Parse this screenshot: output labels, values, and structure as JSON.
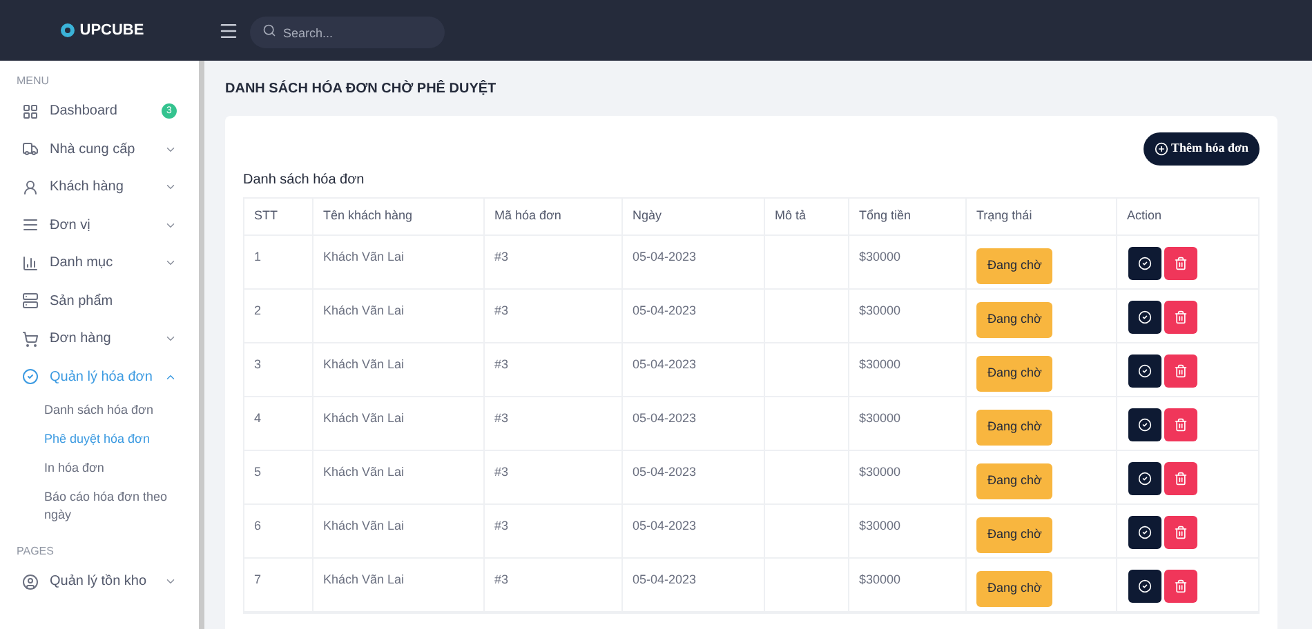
{
  "topbar": {
    "logo": "UPCUBE",
    "search": {
      "placeholder": "Search..."
    }
  },
  "sidebar": {
    "sections": [
      {
        "heading": "MENU",
        "items": [
          {
            "label": "Dashboard",
            "badge": "3",
            "color": "#34c38f",
            "selected": false
          },
          {
            "label": "Nhà cung cấp",
            "expanded": false,
            "selected": false
          },
          {
            "label": "Khách hàng",
            "expanded": false,
            "selected": false
          },
          {
            "label": "Đơn vị",
            "expanded": false,
            "selected": false
          },
          {
            "label": "Danh mục",
            "expanded": false,
            "selected": false
          },
          {
            "label": "Sản phẩm",
            "selected": false
          },
          {
            "label": "Đơn hàng",
            "expanded": false,
            "selected": false
          },
          {
            "label": "Quản lý hóa đơn",
            "expanded": true,
            "selected": true,
            "children": [
              {
                "label": "Danh sách hóa đơn",
                "selected": false
              },
              {
                "label": "Phê duyệt hóa đơn",
                "selected": true
              },
              {
                "label": "In hóa đơn",
                "selected": false
              },
              {
                "label": "Báo cáo hóa đơn theo ngày",
                "selected": false
              }
            ]
          }
        ]
      },
      {
        "heading": "PAGES",
        "items": [
          {
            "label": "Quản lý tồn kho",
            "expanded": false,
            "selected": false
          }
        ]
      }
    ]
  },
  "page": {
    "title": "DANH SÁCH HÓA ĐƠN CHỜ PHÊ DUYỆT",
    "add_button": "Thêm hóa đơn",
    "table": {
      "caption": "Danh sách hóa đơn",
      "columns": [
        "STT",
        "Tên khách hàng",
        "Mã hóa đơn",
        "Ngày",
        "Mô tả",
        "Tổng tiền",
        "Trạng thái",
        "Action"
      ],
      "rows": [
        {
          "stt": "1",
          "customer": "Khách Vãn Lai",
          "code": "#3",
          "date": "05-04-2023",
          "total": "$30000",
          "status": "Đang chờ"
        },
        {
          "stt": "2",
          "customer": "Khách Vãn Lai",
          "code": "#3",
          "date": "05-04-2023",
          "total": "$30000",
          "status": "Đang chờ"
        },
        {
          "stt": "3",
          "customer": "Khách Vãn Lai",
          "code": "#3",
          "date": "05-04-2023",
          "total": "$30000",
          "status": "Đang chờ"
        },
        {
          "stt": "4",
          "customer": "Khách Vãn Lai",
          "code": "#3",
          "date": "05-04-2023",
          "total": "$30000",
          "status": "Đang chờ"
        },
        {
          "stt": "5",
          "customer": "Khách Vãn Lai",
          "code": "#3",
          "date": "05-04-2023",
          "total": "$30000",
          "status": "Đang chờ"
        },
        {
          "stt": "6",
          "customer": "Khách Vãn Lai",
          "code": "#3",
          "date": "05-04-2023",
          "total": "$30000",
          "status": "Đang chờ"
        },
        {
          "stt": "7",
          "customer": "Khách Vãn Lai",
          "code": "#3",
          "date": "05-04-2023",
          "total": "$30000",
          "status": "Đang chờ"
        }
      ]
    }
  }
}
